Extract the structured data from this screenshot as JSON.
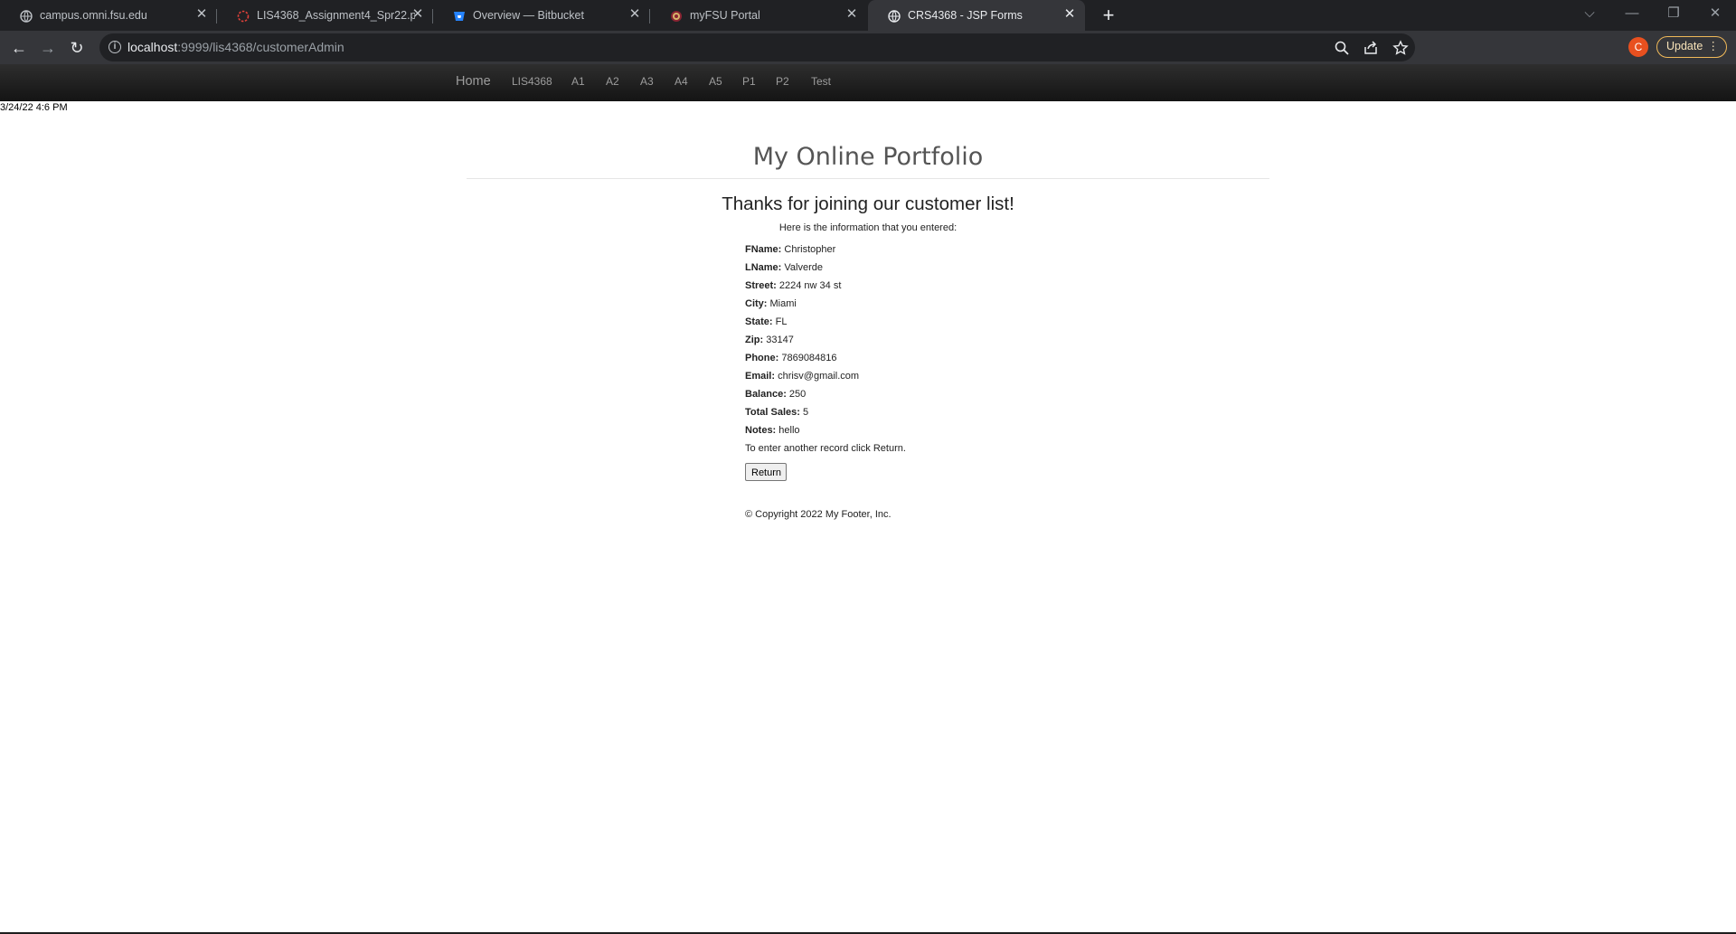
{
  "browser": {
    "tabs": [
      {
        "label": "campus.omni.fsu.edu",
        "icon": "globe-icon",
        "active": false
      },
      {
        "label": "LIS4368_Assignment4_Spr22.pdf",
        "icon": "pdf-loading-icon",
        "active": false
      },
      {
        "label": "Overview — Bitbucket",
        "icon": "bitbucket-icon",
        "active": false
      },
      {
        "label": "myFSU Portal",
        "icon": "fsu-seal-icon",
        "active": false
      },
      {
        "label": "CRS4368 - JSP Forms",
        "icon": "globe-icon",
        "active": true
      }
    ],
    "url_host": "localhost",
    "url_path": ":9999/lis4368/customerAdmin",
    "profile_initial": "C",
    "update_label": "Update",
    "accent_colors": {
      "update_border": "#f0b959",
      "profile": "#e8501f"
    }
  },
  "nav": {
    "home": "Home",
    "items": [
      "LIS4368",
      "A1",
      "A2",
      "A3",
      "A4",
      "A5",
      "P1",
      "P2",
      "Test"
    ]
  },
  "timestamp": "3/24/22 4:6 PM",
  "page_title": "My Online Portfolio",
  "heading": "Thanks for joining our customer list!",
  "intro": "Here is the information that you entered:",
  "fields": [
    {
      "label": "FName:",
      "value": "Christopher"
    },
    {
      "label": "LName:",
      "value": "Valverde"
    },
    {
      "label": "Street:",
      "value": "2224 nw 34 st"
    },
    {
      "label": "City:",
      "value": "Miami"
    },
    {
      "label": "State:",
      "value": "FL"
    },
    {
      "label": "Zip:",
      "value": "33147"
    },
    {
      "label": "Phone:",
      "value": "7869084816"
    },
    {
      "label": "Email:",
      "value": "chrisv@gmail.com"
    },
    {
      "label": "Balance:",
      "value": "250"
    },
    {
      "label": "Total Sales:",
      "value": "5"
    },
    {
      "label": "Notes:",
      "value": "hello"
    }
  ],
  "return_text": "To enter another record click Return.",
  "return_button": "Return",
  "footer": "© Copyright 2022 My Footer, Inc."
}
